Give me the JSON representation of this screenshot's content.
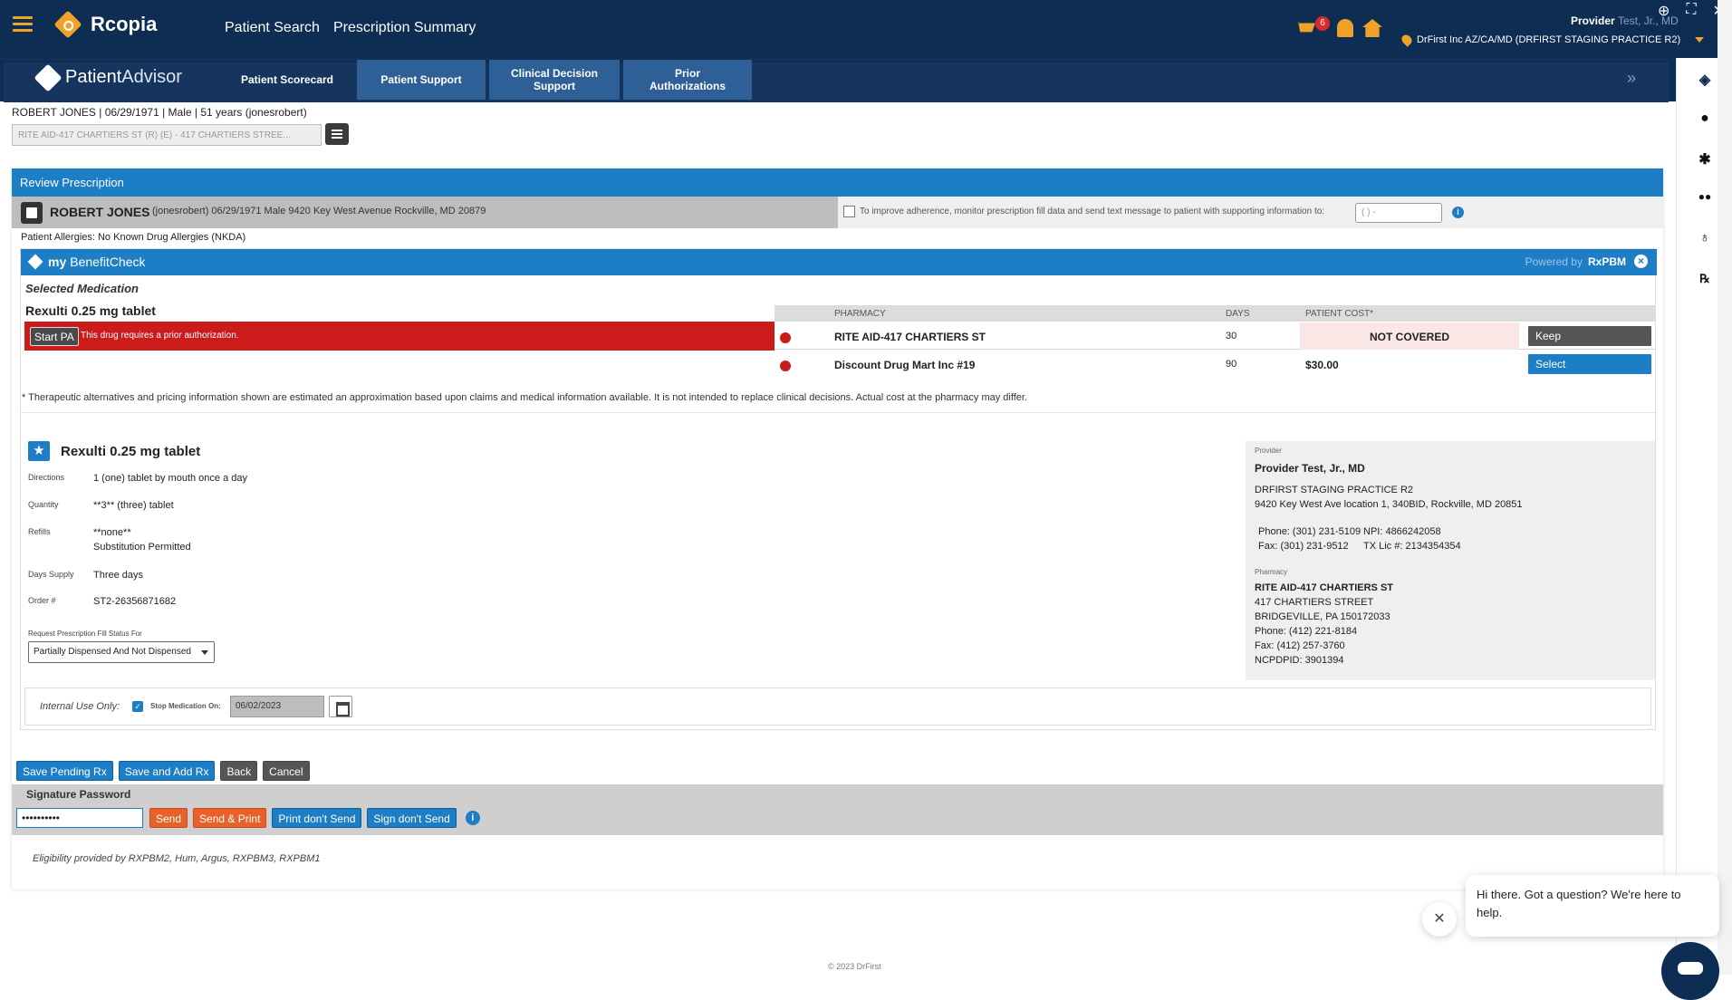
{
  "header": {
    "app_name": "Rcopia",
    "nav": [
      "Patient Search",
      "Prescription Summary"
    ],
    "cart_badge": "6",
    "provider_label": "Provider",
    "provider_name": "Test, Jr., MD",
    "practice": "DrFirst Inc AZ/CA/MD (DRFIRST STAGING PRACTICE R2)",
    "colors": {
      "navy": "#0d2d52",
      "accent": "#f0a12a",
      "blue": "#1d7ec6",
      "red": "#cc1b1b",
      "orange": "#e8602a"
    }
  },
  "patient_advisor": {
    "logo_bold": "Patient",
    "logo_light": "Advisor",
    "tabs": [
      {
        "label": "Patient Scorecard",
        "active": false
      },
      {
        "label": "Patient Support",
        "active": true
      },
      {
        "label": "Clinical Decision Support",
        "active": true
      },
      {
        "label": "Prior Authorizations",
        "active": true
      }
    ]
  },
  "right_sidebar_icons": [
    "patient-advisor-icon",
    "person-icon",
    "asterisk-icon",
    "glasses-icon",
    "stethoscope-icon",
    "rx-icon"
  ],
  "patient": {
    "summary": "ROBERT JONES | 06/29/1971 | Male | 51 years (jonesrobert)",
    "pharmacy_select": "RITE AID-417 CHARTIERS ST (R) (E) - 417 CHARTIERS STREE..."
  },
  "review": {
    "title": "Review Prescription",
    "name": "ROBERT JONES",
    "details": "(jonesrobert) 06/29/1971  Male  9420 Key West Avenue Rockville, MD 20879",
    "adherence_text": "To improve adherence, monitor prescription fill data and send text message to patient with supporting information to:",
    "phone_placeholder": "(  )  -",
    "allergies": "Patient Allergies: No Known Drug Allergies (NKDA)"
  },
  "benefit_check": {
    "logo_bold": "my",
    "logo_light": "BenefitCheck",
    "powered_by": "Powered by",
    "powered_brand": "RxPBM",
    "selected_label": "Selected Medication",
    "medication": "Rexulti 0.25 mg tablet",
    "start_pa": "Start PA",
    "pa_message": "This drug requires a prior authorization.",
    "columns": [
      "PHARMACY",
      "DAYS",
      "PATIENT COST*"
    ],
    "rows": [
      {
        "pharmacy": "RITE AID-417 CHARTIERS ST",
        "days": "30",
        "cost": "NOT COVERED",
        "action": "Keep"
      },
      {
        "pharmacy": "Discount Drug Mart Inc #19",
        "days": "90",
        "cost": "$30.00",
        "action": "Select"
      }
    ],
    "disclaimer": "* Therapeutic alternatives and pricing information shown are estimated an approximation based upon claims and medical information available. It is not intended to replace clinical decisions. Actual cost at the pharmacy may differ."
  },
  "prescription": {
    "medication": "Rexulti 0.25 mg tablet",
    "fields": [
      {
        "label": "Directions",
        "value": "1 (one) tablet by mouth once a day"
      },
      {
        "label": "Quantity",
        "value": "**3** (three) tablet"
      },
      {
        "label": "Refills",
        "value": "**none**",
        "value2": "Substitution Permitted"
      },
      {
        "label": "Days Supply",
        "value": "Three days"
      },
      {
        "label": "Order #",
        "value": "ST2-26356871682"
      }
    ],
    "fill_status_label": "Request Prescription Fill Status For",
    "fill_status_value": "Partially Dispensed And Not Dispensed",
    "internal_use": "Internal Use Only:",
    "stop_label": "Stop Medication On:",
    "stop_date": "06/02/2023"
  },
  "provider_card": {
    "provider_label": "Provider",
    "provider_name": "Provider Test, Jr., MD",
    "practice": "DRFIRST STAGING PRACTICE R2",
    "address": "9420 Key West Ave location 1, 340BID, Rockville, MD 20851",
    "phone": "Phone: (301) 231-5109",
    "npi": "NPI: 4866242058",
    "fax": "Fax: (301) 231-9512",
    "tx_lic": "TX Lic #: 2134354354",
    "pharmacy_label": "Pharmacy",
    "pharmacy_name": "RITE AID-417 CHARTIERS ST",
    "pharmacy_lines": [
      "417 CHARTIERS STREET",
      "BRIDGEVILLE, PA 150172033",
      "Phone: (412) 221-8184",
      "Fax: (412) 257-3760",
      "NCPDPID: 3901394"
    ]
  },
  "actions": {
    "save_pending": "Save Pending Rx",
    "save_add": "Save and Add Rx",
    "back": "Back",
    "cancel": "Cancel",
    "signature_label": "Signature Password",
    "signature_value": "••••••••••",
    "send": "Send",
    "send_print": "Send & Print",
    "print_dont_send": "Print don't Send",
    "sign_dont_send": "Sign don't Send"
  },
  "eligibility": "Eligibility provided by RXPBM2, Hum, Argus, RXPBM3, RXPBM1",
  "footer": "© 2023 DrFirst",
  "chat": {
    "message": "Hi there. Got a question? We're here to help."
  }
}
